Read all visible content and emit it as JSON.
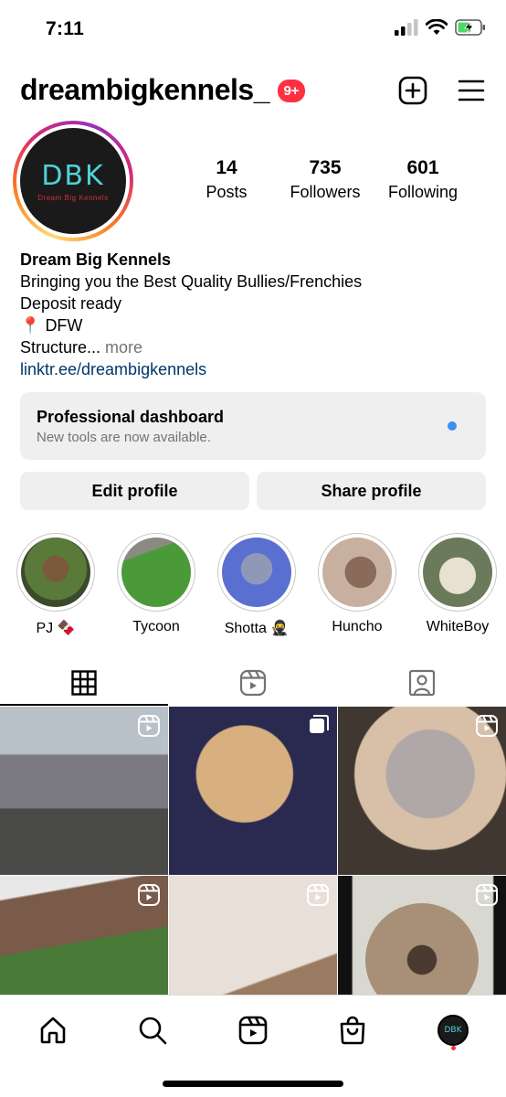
{
  "status_bar": {
    "time": "7:11"
  },
  "header": {
    "username": "dreambigkennels_",
    "notification_badge": "9+"
  },
  "profile": {
    "avatar": {
      "logo_text": "DBK",
      "logo_subtext": "Dream Big Kennels"
    },
    "stats": [
      {
        "value": "14",
        "label": "Posts"
      },
      {
        "value": "735",
        "label": "Followers"
      },
      {
        "value": "601",
        "label": "Following"
      }
    ],
    "bio": {
      "name": "Dream Big Kennels",
      "line1": "Bringing you the Best Quality Bullies/Frenchies",
      "line2": "Deposit ready",
      "line3_icon": "📍",
      "line3": "DFW",
      "line4": "Structure...",
      "more": "more",
      "link": "linktr.ee/dreambigkennels"
    }
  },
  "dashboard": {
    "title": "Professional dashboard",
    "subtitle": "New tools are now available."
  },
  "buttons": {
    "edit": "Edit profile",
    "share": "Share profile"
  },
  "highlights": [
    {
      "label": "PJ 🍫",
      "color": "#5a6a3a"
    },
    {
      "label": "Tycoon",
      "color": "#4a8a3a"
    },
    {
      "label": "Shotta 🥷",
      "color": "#6a80c8"
    },
    {
      "label": "Huncho",
      "color": "#b89a88"
    },
    {
      "label": "WhiteBoy",
      "color": "#c8d0c0"
    }
  ],
  "posts": [
    {
      "color": "#8a7a70",
      "icon": "reel-icon"
    },
    {
      "color": "#c9a070",
      "icon": "carousel-icon"
    },
    {
      "color": "#a89890",
      "icon": "reel-icon"
    },
    {
      "color": "#5a8a40",
      "icon": "reel-icon"
    },
    {
      "color": "#d8cfc8",
      "icon": "reel-icon"
    },
    {
      "color": "#8a7a6a",
      "icon": "reel-icon"
    }
  ]
}
